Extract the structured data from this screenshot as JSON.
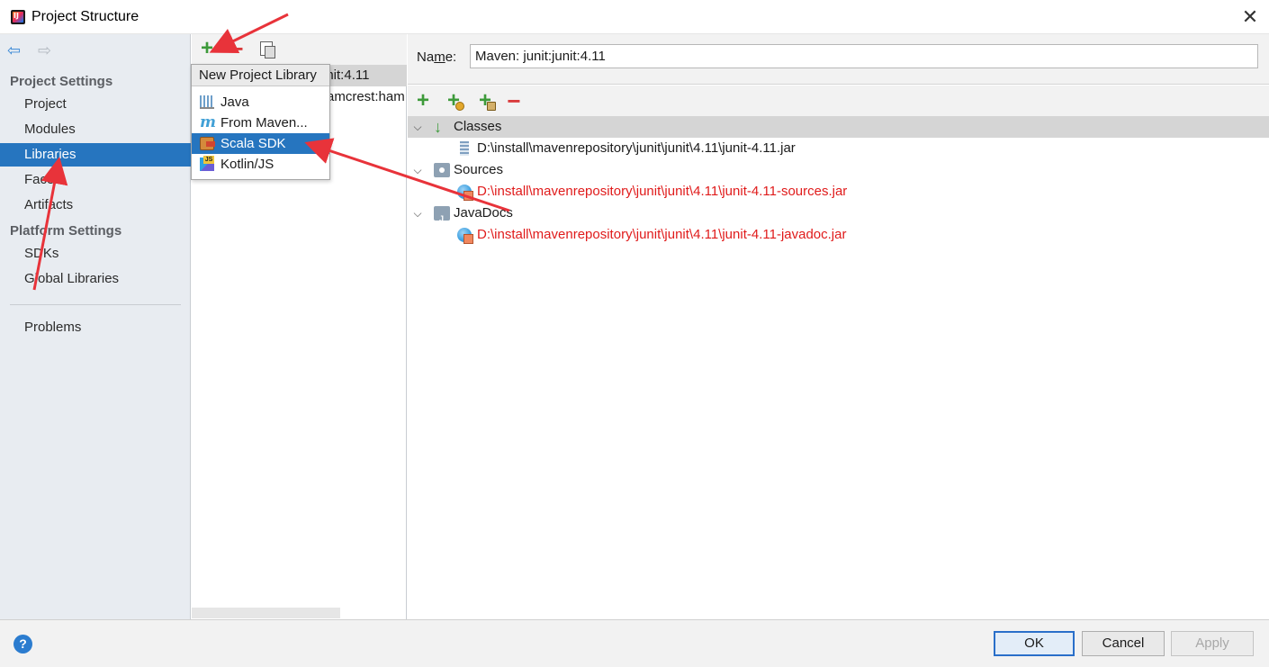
{
  "window": {
    "title": "Project Structure",
    "close_glyph": "✕"
  },
  "sidebar": {
    "back_glyph": "⇦",
    "forward_glyph": "⇨",
    "sections": [
      {
        "label": "Project Settings"
      },
      {
        "label": "Platform Settings"
      }
    ],
    "items": [
      {
        "label": "Project",
        "selected": false
      },
      {
        "label": "Modules",
        "selected": false
      },
      {
        "label": "Libraries",
        "selected": true
      },
      {
        "label": "Facets",
        "selected": false
      },
      {
        "label": "Artifacts",
        "selected": false
      },
      {
        "label": "SDKs",
        "selected": false
      },
      {
        "label": "Global Libraries",
        "selected": false
      },
      {
        "label": "Problems",
        "selected": false
      }
    ]
  },
  "library_list": {
    "toolbar": {
      "add_glyph": "+",
      "remove_glyph": "−"
    },
    "rows": [
      {
        "text": "unit:4.11",
        "highlighted": true
      },
      {
        "text": "amcrest:ham",
        "highlighted": false
      }
    ]
  },
  "new_library_popup": {
    "title": "New Project Library",
    "items": [
      {
        "label": "Java",
        "icon": "java-library-icon",
        "selected": false
      },
      {
        "label": "From Maven...",
        "icon": "maven-icon",
        "selected": false
      },
      {
        "label": "Scala SDK",
        "icon": "scala-sdk-icon",
        "selected": true
      },
      {
        "label": "Kotlin/JS",
        "icon": "kotlin-js-icon",
        "selected": false
      }
    ]
  },
  "detail": {
    "name_label_prefix": "Na",
    "name_label_mnemonic": "m",
    "name_label_suffix": "e:",
    "name_value": "Maven: junit:junit:4.11",
    "toolbar": {
      "add_glyph": "+",
      "remove_glyph": "−"
    },
    "tree": [
      {
        "category": "Classes",
        "chevron": "⌵",
        "icon": "classes-icon",
        "icon_glyph": "↓",
        "highlighted": true,
        "entries": [
          {
            "path": "D:\\install\\mavenrepository\\junit\\junit\\4.11\\junit-4.11.jar",
            "missing": false,
            "icon": "jar-icon"
          }
        ]
      },
      {
        "category": "Sources",
        "chevron": "⌵",
        "icon": "sources-folder-icon",
        "icon_glyph": "",
        "highlighted": false,
        "entries": [
          {
            "path": "D:\\install\\mavenrepository\\junit\\junit\\4.11\\junit-4.11-sources.jar",
            "missing": true,
            "icon": "web-resource-icon"
          }
        ]
      },
      {
        "category": "JavaDocs",
        "chevron": "⌵",
        "icon": "javadocs-folder-icon",
        "icon_glyph": "",
        "highlighted": false,
        "entries": [
          {
            "path": "D:\\install\\mavenrepository\\junit\\junit\\4.11\\junit-4.11-javadoc.jar",
            "missing": true,
            "icon": "web-resource-icon"
          }
        ]
      }
    ]
  },
  "footer": {
    "help_glyph": "?",
    "ok_label": "OK",
    "cancel_label": "Cancel",
    "apply_label": "Apply"
  },
  "colors": {
    "selection": "#2675bf",
    "annotation_arrow": "#e8333a",
    "missing_path": "#e01b1b",
    "add_green": "#3d9a3a",
    "remove_red": "#d9393a"
  }
}
